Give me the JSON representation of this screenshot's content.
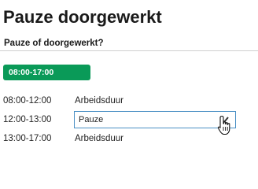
{
  "page": {
    "title": "Pauze doorgewerkt",
    "subtitle": "Pauze of doorgewerkt?"
  },
  "shift_chip": {
    "label": "08:00-17:00",
    "color": "#0a9a58"
  },
  "rows": [
    {
      "time": "08:00-12:00",
      "type": "Arbeidsduur"
    },
    {
      "time": "12:00-13:00",
      "type": "Pauze",
      "editable": true
    },
    {
      "time": "13:00-17:00",
      "type": "Arbeidsduur"
    }
  ],
  "icons": {
    "dropdown": "chevron-down-icon",
    "cursor": "hand-pointer-icon"
  },
  "accent_border": "#4a8fc4"
}
